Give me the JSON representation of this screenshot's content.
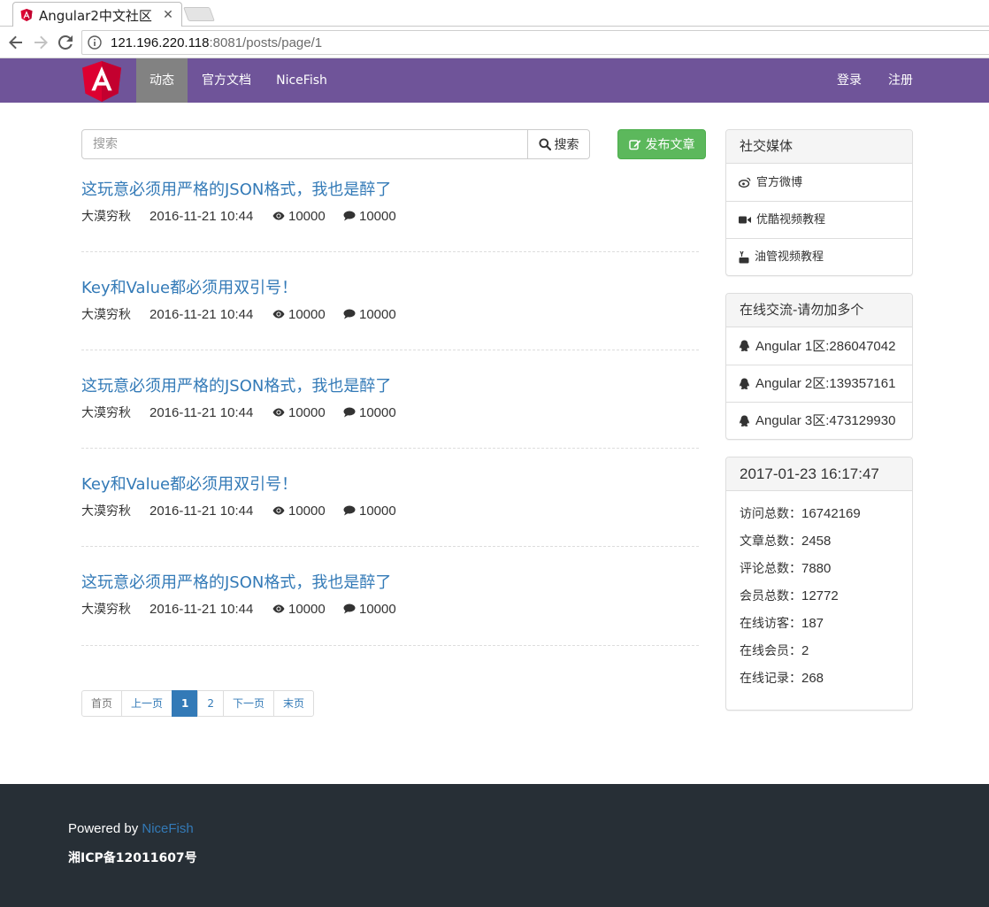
{
  "browser": {
    "tab_title": "Angular2中文社区",
    "close_glyph": "✕",
    "url_host": "121.196.220.118",
    "url_rest": ":8081/posts/page/1"
  },
  "navbar": {
    "logo_alt": "angular-logo",
    "items": [
      {
        "label": "动态",
        "active": true
      },
      {
        "label": "官方文档",
        "active": false
      },
      {
        "label": "NiceFish",
        "active": false
      }
    ],
    "right_items": [
      {
        "label": "登录"
      },
      {
        "label": "注册"
      }
    ],
    "background": "#6f5499",
    "active_background": "#828282"
  },
  "search": {
    "placeholder": "搜索",
    "value": "",
    "button_label": "搜索",
    "button_icon": "search-icon"
  },
  "publish_button": {
    "label": "发布文章",
    "icon": "edit-icon",
    "color": "#5cb85c"
  },
  "posts": [
    {
      "title": "这玩意必须用严格的JSON格式，我也是醉了",
      "author": "大漠穷秋",
      "date": "2016-11-21 10:44",
      "views": "10000",
      "comments": "10000"
    },
    {
      "title": "Key和Value都必须用双引号！",
      "author": "大漠穷秋",
      "date": "2016-11-21 10:44",
      "views": "10000",
      "comments": "10000"
    },
    {
      "title": "这玩意必须用严格的JSON格式，我也是醉了",
      "author": "大漠穷秋",
      "date": "2016-11-21 10:44",
      "views": "10000",
      "comments": "10000"
    },
    {
      "title": "Key和Value都必须用双引号！",
      "author": "大漠穷秋",
      "date": "2016-11-21 10:44",
      "views": "10000",
      "comments": "10000"
    },
    {
      "title": "这玩意必须用严格的JSON格式，我也是醉了",
      "author": "大漠穷秋",
      "date": "2016-11-21 10:44",
      "views": "10000",
      "comments": "10000"
    }
  ],
  "pagination": {
    "first": "首页",
    "prev": "上一页",
    "pages": [
      "1",
      "2"
    ],
    "current": "1",
    "next": "下一页",
    "last": "末页"
  },
  "social_panel": {
    "heading": "社交媒体",
    "items": [
      {
        "label": "官方微博",
        "icon": "weibo-icon"
      },
      {
        "label": "优酷视频教程",
        "icon": "video-camera-icon"
      },
      {
        "label": "油管视频教程",
        "icon": "youtube-icon"
      }
    ]
  },
  "qq_panel": {
    "heading": "在线交流-请勿加多个",
    "items": [
      {
        "label": "Angular 1区:286047042",
        "icon": "qq-icon"
      },
      {
        "label": "Angular 2区:139357161",
        "icon": "qq-icon"
      },
      {
        "label": "Angular 3区:473129930",
        "icon": "qq-icon"
      }
    ]
  },
  "stats_panel": {
    "heading": "2017-01-23 16:17:47",
    "rows": [
      {
        "label": "访问总数：",
        "value": "16742169"
      },
      {
        "label": "文章总数：",
        "value": "2458"
      },
      {
        "label": "评论总数：",
        "value": "7880"
      },
      {
        "label": "会员总数：",
        "value": "12772"
      },
      {
        "label": "在线访客：",
        "value": "187"
      },
      {
        "label": "在线会员：",
        "value": "2"
      },
      {
        "label": "在线记录：",
        "value": "268"
      }
    ]
  },
  "footer": {
    "powered_by": "Powered by ",
    "brand": "NiceFish",
    "icp": "湘ICP备12011607号",
    "background": "#272f36"
  }
}
